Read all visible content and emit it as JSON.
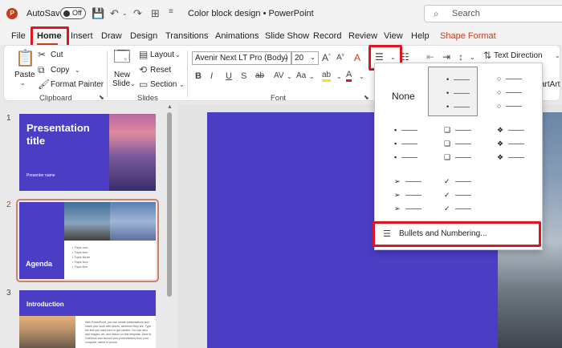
{
  "titlebar": {
    "logo_letter": "P",
    "autosave_label": "AutoSave",
    "autosave_state": "Off",
    "doc_title": "Color block design",
    "app_sep": "•",
    "app_name": "PowerPoint",
    "search_placeholder": "Search"
  },
  "tabs": [
    {
      "label": "File"
    },
    {
      "label": "Home"
    },
    {
      "label": "Insert"
    },
    {
      "label": "Draw"
    },
    {
      "label": "Design"
    },
    {
      "label": "Transitions"
    },
    {
      "label": "Animations"
    },
    {
      "label": "Slide Show"
    },
    {
      "label": "Record"
    },
    {
      "label": "Review"
    },
    {
      "label": "View"
    },
    {
      "label": "Help"
    },
    {
      "label": "Shape Format"
    }
  ],
  "ribbon": {
    "clipboard": {
      "paste": "Paste",
      "cut": "Cut",
      "copy": "Copy",
      "format_painter": "Format Painter",
      "group": "Clipboard"
    },
    "slides": {
      "new_slide_1": "New",
      "new_slide_2": "Slide",
      "layout": "Layout",
      "reset": "Reset",
      "section": "Section",
      "group": "Slides"
    },
    "font": {
      "name": "Avenir Next LT Pro (Body)",
      "size": "20",
      "grow": "A",
      "shrink": "A",
      "clear": "A",
      "bold": "B",
      "italic": "I",
      "underline": "U",
      "strike": "S",
      "shadow": "ab",
      "spacing": "AV",
      "case": "Aa",
      "highlight": "ab",
      "color": "A",
      "group": "Font"
    },
    "paragraph": {
      "text_direction": "Text Direction",
      "smartart": "artArt"
    }
  },
  "bullet_gallery": {
    "none": "None",
    "items_label": "Bullets and Numbering...",
    "glyphs": {
      "filled_round": "•",
      "hollow_round": "○",
      "filled_square": "▪",
      "hollow_square": "❑",
      "diamond": "❖",
      "arrow": "➢",
      "check": "✓"
    }
  },
  "slides": [
    {
      "number": "1",
      "title_1": "Presentation",
      "title_2": "title",
      "subtitle": "Presenter name"
    },
    {
      "number": "2",
      "title": "Agenda",
      "items": [
        "Topic one",
        "Topic two",
        "Topic three",
        "Topic four",
        "Topic five"
      ]
    },
    {
      "number": "3",
      "title": "Introduction",
      "body": "With PowerPoint, you can create presentations and share your work with others, wherever they are. Type the text you want here to get started. You can also add images, art, and videos on this template. Save to OneDrive and access your presentations from your computer, tablet or phone."
    }
  ],
  "colors": {
    "accent": "#c43e1c",
    "slide_bg": "#4c3dc5",
    "highlight_box": "#e0141e"
  }
}
